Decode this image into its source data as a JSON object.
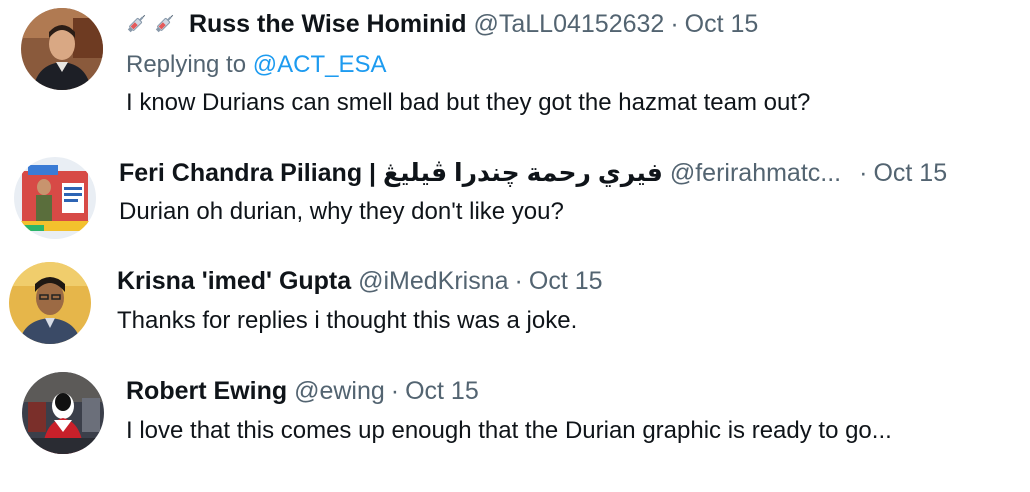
{
  "tweets": [
    {
      "display_name": "Russ the Wise Hominid",
      "handle": "@TaLL04152632",
      "separator": "·",
      "date": "Oct 15",
      "replying_prefix": "Replying to",
      "replying_handle": "@ACT_ESA",
      "text": "I know Durians can smell bad but they got the hazmat team out?",
      "name_emoji": [
        "syringe-icon",
        "syringe-icon"
      ]
    },
    {
      "display_name": "Feri Chandra Piliang | فيري رحمة چندرا ڤيليڠ",
      "handle": "@ferirahmatc...",
      "separator": "·",
      "date": "Oct 15",
      "text": "Durian oh durian, why they don't like you?"
    },
    {
      "display_name": "Krisna 'imed' Gupta",
      "handle": "@iMedKrisna",
      "separator": "·",
      "date": "Oct 15",
      "text": "Thanks for replies i thought this was a joke."
    },
    {
      "display_name": "Robert Ewing",
      "handle": "@ewing",
      "separator": "·",
      "date": "Oct 15",
      "text": "I love that this comes up enough that the Durian graphic is ready to go..."
    }
  ],
  "colors": {
    "text_primary": "#0f1419",
    "text_secondary": "#536471",
    "link": "#1d9bf0"
  }
}
